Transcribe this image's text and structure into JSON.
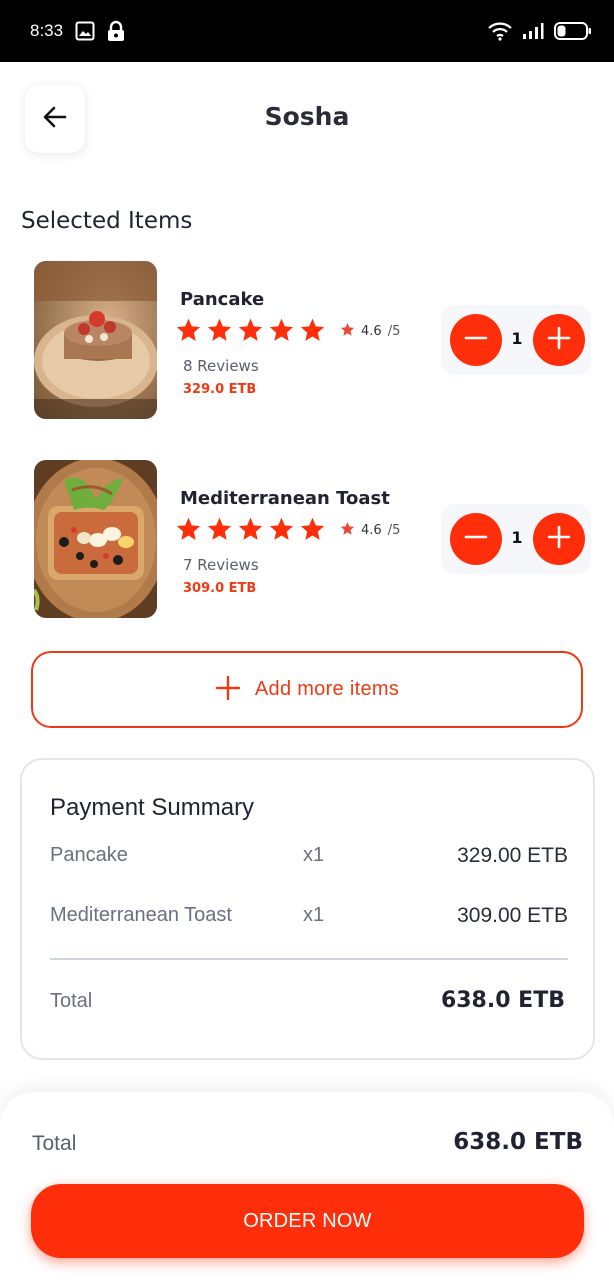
{
  "status_bar": {
    "time": "8:33"
  },
  "header": {
    "title": "Sosha"
  },
  "section_title": "Selected Items",
  "items": [
    {
      "name": "Pancake",
      "stars": 5,
      "rating": "4.6",
      "rating_max": "/5",
      "reviews": "8 Reviews",
      "price": "329.0 ETB",
      "quantity": "1"
    },
    {
      "name": "Mediterranean Toast",
      "stars": 5,
      "rating": "4.6",
      "rating_max": "/5",
      "reviews": "7 Reviews",
      "price": "309.0 ETB",
      "quantity": "1"
    }
  ],
  "add_more_label": "Add more items",
  "summary": {
    "title": "Payment Summary",
    "rows": [
      {
        "name": "Pancake",
        "qty": "x1",
        "price": "329.00 ETB"
      },
      {
        "name": "Mediterranean Toast",
        "qty": "x1",
        "price": "309.00 ETB"
      }
    ],
    "total_label": "Total",
    "total_value": "638.0 ETB"
  },
  "bottom": {
    "total_label": "Total",
    "total_value": "638.0 ETB",
    "order_label": "ORDER NOW"
  },
  "colors": {
    "accent": "#ff2e0a",
    "accent_text": "#ee3a14",
    "star": "#ff2e0a"
  },
  "icons": {
    "back": "arrow-left-icon",
    "minus": "minus-icon",
    "plus": "plus-icon",
    "star": "star-icon",
    "wifi": "wifi-icon",
    "signal": "signal-icon",
    "battery": "battery-icon",
    "image": "image-icon",
    "lock": "lock-icon"
  }
}
